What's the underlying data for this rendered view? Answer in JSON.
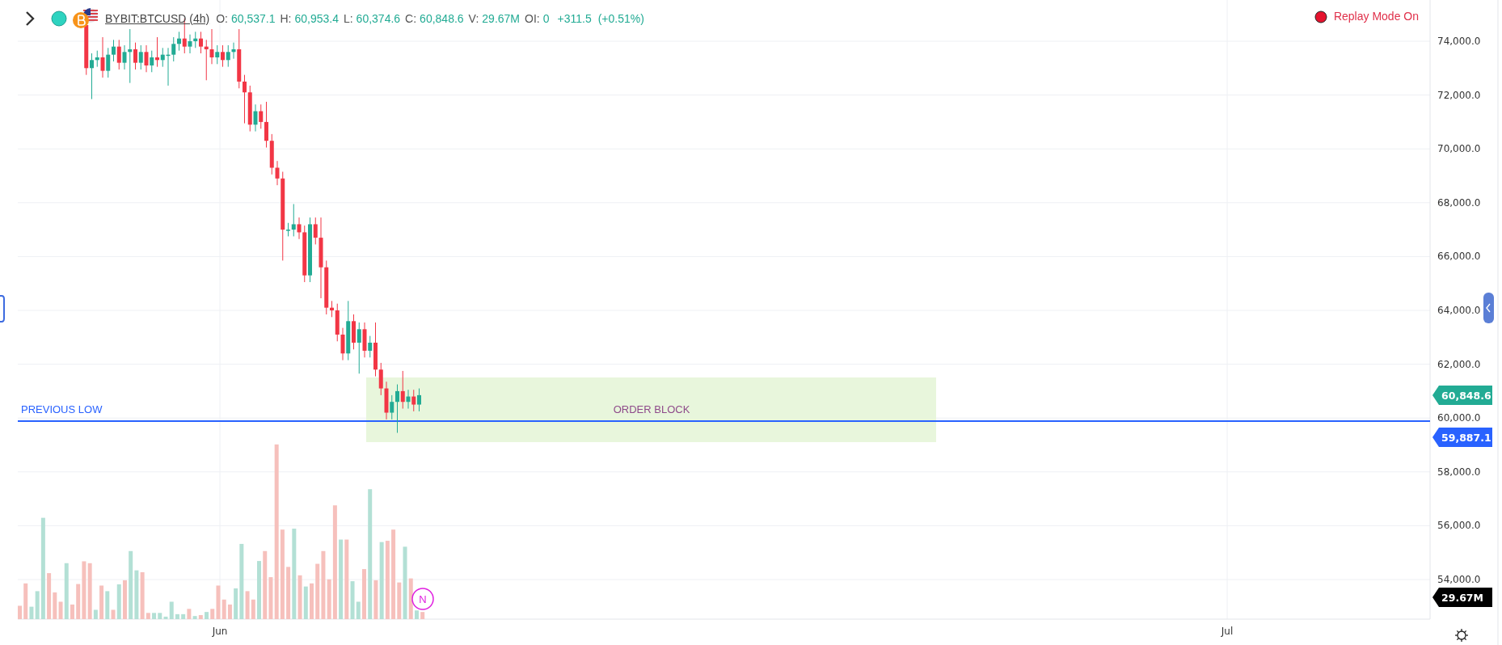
{
  "header": {
    "symbol": "BYBIT:BTCUSD (4h)",
    "stats": [
      {
        "label": "O:",
        "value": "60,537.1"
      },
      {
        "label": "H:",
        "value": "60,953.4"
      },
      {
        "label": "L:",
        "value": "60,374.6"
      },
      {
        "label": "C:",
        "value": "60,848.6"
      },
      {
        "label": "V:",
        "value": "29.67M"
      },
      {
        "label": "OI:",
        "value": "0"
      }
    ],
    "change": "+311.5",
    "change_pct": "(+0.51%)"
  },
  "replay": {
    "label": "Replay Mode On",
    "on": true
  },
  "price_axis": {
    "labels": [
      "74,000.0",
      "72,000.0",
      "70,000.0",
      "68,000.0",
      "66,000.0",
      "64,000.0",
      "62,000.0",
      "60,000.0",
      "58,000.0",
      "56,000.0",
      "54,000.0"
    ]
  },
  "time_axis": {
    "labels": [
      "Jun",
      "Jul"
    ]
  },
  "drawings": [
    {
      "kind": "hline",
      "label": "PREVIOUS LOW"
    },
    {
      "kind": "rect",
      "label": "ORDER BLOCK"
    }
  ],
  "price_tags": [
    {
      "kind": "last",
      "value": "60,848.6",
      "color": "#22ab94"
    },
    {
      "kind": "line",
      "value": "59,887.1",
      "color": "#2962ff"
    },
    {
      "kind": "volume",
      "value": "29.67M",
      "color": "#000000"
    }
  ],
  "marker": {
    "label": "N"
  }
}
